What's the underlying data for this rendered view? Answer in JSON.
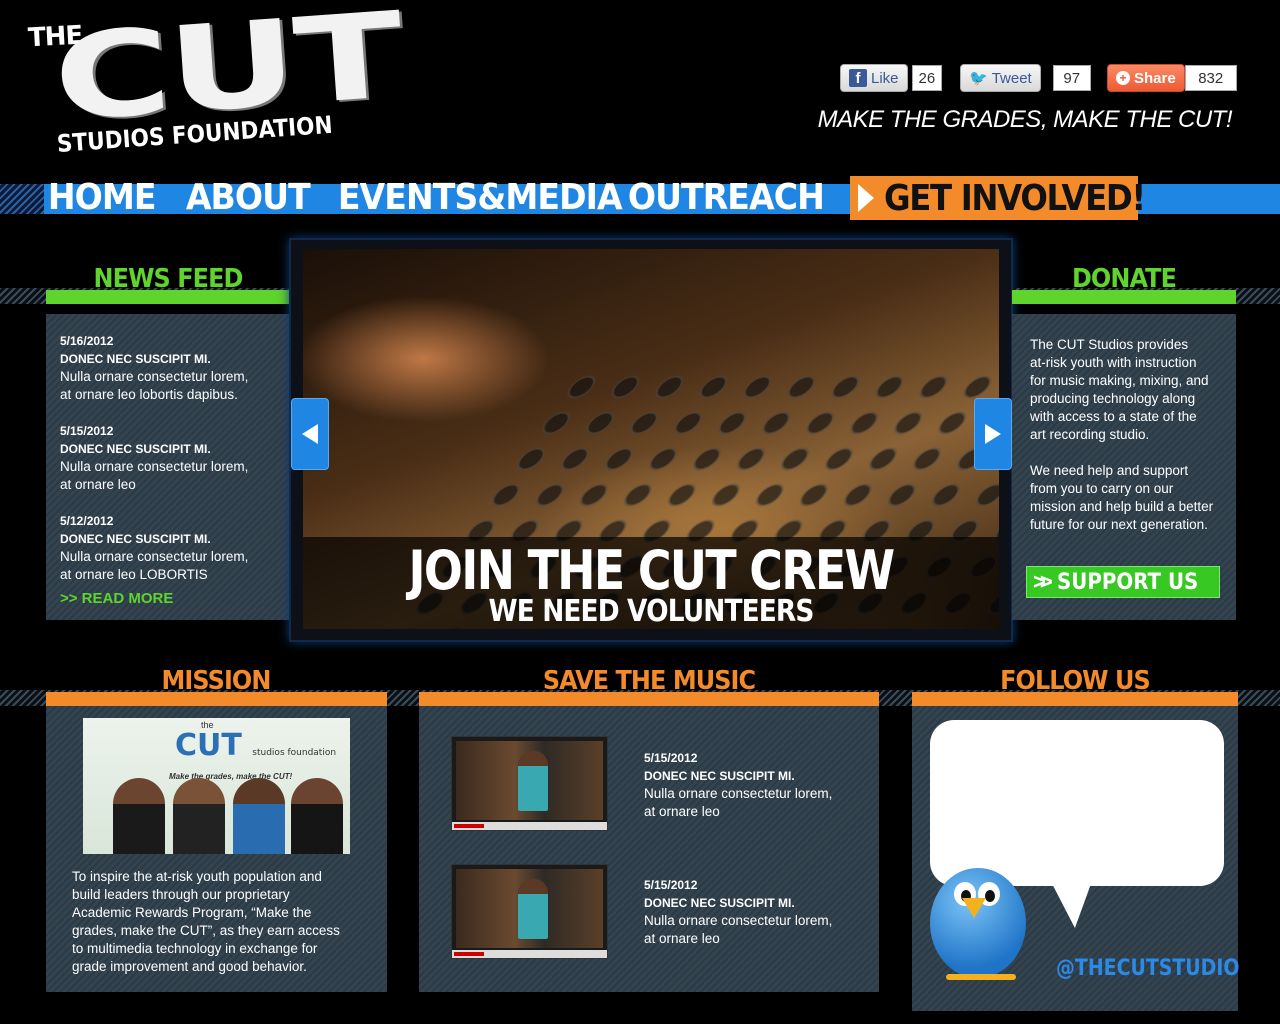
{
  "logo": {
    "the": "THE",
    "cut": "CUT",
    "studios": "STUDIOS FOUNDATION"
  },
  "social": {
    "like_label": "Like",
    "like_count": "26",
    "tweet_label": "Tweet",
    "tweet_count": "97",
    "share_label": "Share",
    "share_count": "832",
    "icons": [
      "facebook-icon",
      "twitter-icon",
      "share-icon"
    ]
  },
  "tagline": "MAKE THE GRADES, MAKE THE CUT!",
  "nav": {
    "items": [
      "HOME",
      "ABOUT",
      "EVENTS&MEDIA",
      "OUTREACH"
    ],
    "cta": "GET INVOLVED!",
    "colors": {
      "nav_blue": "#1f86e3",
      "cta_orange": "#f48b2b"
    }
  },
  "news": {
    "title": "NEWS FEED",
    "entries": [
      {
        "date": "5/16/2012",
        "title": "DONEC NEC SUSCIPIT MI.",
        "line1": "Nulla ornare consectetur lorem,",
        "line2": "at ornare leo lobortis dapibus."
      },
      {
        "date": "5/15/2012",
        "title": "DONEC NEC SUSCIPIT MI.",
        "line1": "Nulla ornare consectetur lorem,",
        "line2": "at ornare leo"
      },
      {
        "date": "5/12/2012",
        "title": "DONEC NEC SUSCIPIT MI.",
        "line1": "Nulla ornare consectetur lorem,",
        "line2": "at ornare leo LOBORTIS"
      }
    ],
    "read_more": ">> READ MORE"
  },
  "slider": {
    "headline": "JOIN THE CUT CREW",
    "subline": "WE NEED VOLUNTEERS"
  },
  "donate": {
    "title": "DONATE",
    "para1": [
      "The CUT Studios provides",
      "at-risk youth with instruction",
      "for music making, mixing, and",
      "producing technology along",
      "with access to a state of the",
      "art recording studio."
    ],
    "para2": [
      "We need help and support",
      "from you to carry on our",
      "mission and help build a better",
      "future for our next generation."
    ],
    "button": "SUPPORT US",
    "button_icon": ">>"
  },
  "mission": {
    "title": "MISSION",
    "photo_logo": "CUT",
    "photo_the": "the",
    "photo_sub": "studios foundation",
    "photo_tag": "Make the grades, make the CUT!",
    "text": [
      "To inspire the at-risk youth population and",
      "build leaders through our proprietary",
      "Academic Rewards Program, “Make the",
      "grades, make the CUT”, as they earn access",
      "to multimedia technology in exchange for",
      "grade improvement and good behavior."
    ]
  },
  "music": {
    "title": "SAVE THE MUSIC",
    "videos": [
      {
        "date": "5/15/2012",
        "title": "DONEC NEC SUSCIPIT MI.",
        "line1": "Nulla ornare consectetur lorem,",
        "line2": "at ornare leo"
      },
      {
        "date": "5/15/2012",
        "title": "DONEC NEC SUSCIPIT MI.",
        "line1": "Nulla ornare consectetur lorem,",
        "line2": "at ornare leo"
      }
    ]
  },
  "follow": {
    "title": "FOLLOW US",
    "handle": "@THECUTSTUDIO"
  }
}
